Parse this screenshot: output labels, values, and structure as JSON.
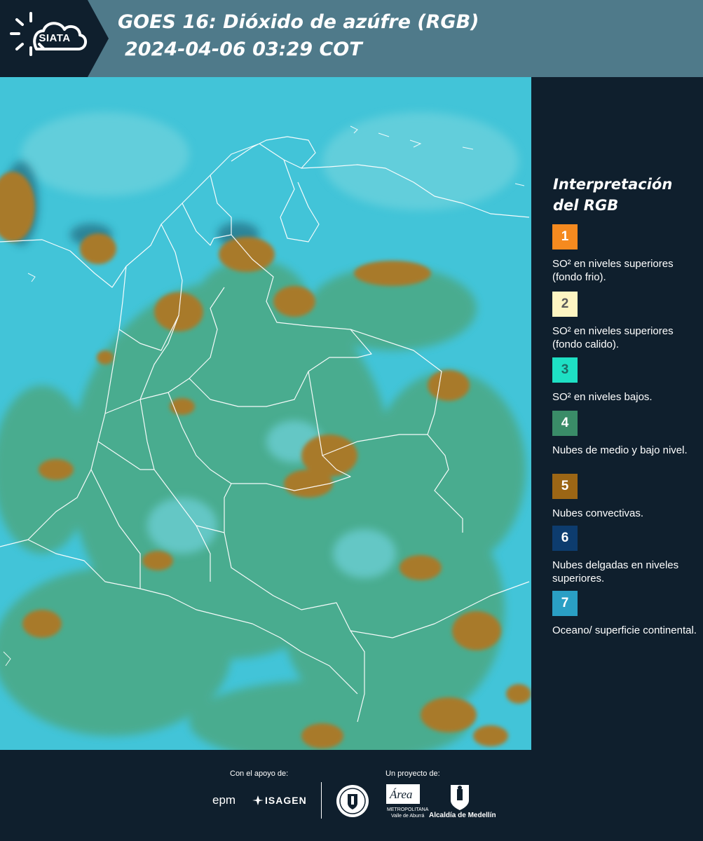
{
  "header": {
    "logo_text": "SIATA",
    "title_line1": "GOES 16: Dióxido de azúfre (RGB)",
    "title_line2": "2024-04-06 03:29 COT"
  },
  "legend": {
    "title": "Interpretación del RGB",
    "items": [
      {
        "num": "1",
        "color": "#f58a1f",
        "text_color": "#ffffff",
        "desc": "SO² en niveles superiores (fondo frio)."
      },
      {
        "num": "2",
        "color": "#fdf5c2",
        "text_color": "#5a5a5a",
        "desc": "SO² en niveles superiores (fondo calido)."
      },
      {
        "num": "3",
        "color": "#1ee0c4",
        "text_color": "#1c6a64",
        "desc": "SO² en niveles bajos."
      },
      {
        "num": "4",
        "color": "#3a8c68",
        "text_color": "#ffffff",
        "desc": "Nubes de medio y bajo nivel."
      },
      {
        "num": "5",
        "color": "#9c6615",
        "text_color": "#ffffff",
        "desc": "Nubes convectivas."
      },
      {
        "num": "6",
        "color": "#0d3c6e",
        "text_color": "#ffffff",
        "desc": "Nubes delgadas en niveles superiores."
      },
      {
        "num": "7",
        "color": "#2a9fc4",
        "text_color": "#ffffff",
        "desc": "Oceano/ superficie continental."
      }
    ]
  },
  "footer": {
    "support_label": "Con el apoyo de:",
    "project_label": "Un proyecto de:",
    "sponsor1": "epm",
    "sponsor2": "ISAGEN",
    "partner_area": "Área",
    "partner_area_sub1": "METROPOLITANA",
    "partner_area_sub2": "Valle de Aburrá",
    "partner_alcaldia": "Alcaldía de Medellín"
  },
  "icons": [
    "sun-icon",
    "cloud-icon",
    "university-seal-icon",
    "coat-of-arms-icon",
    "isagen-icon"
  ]
}
